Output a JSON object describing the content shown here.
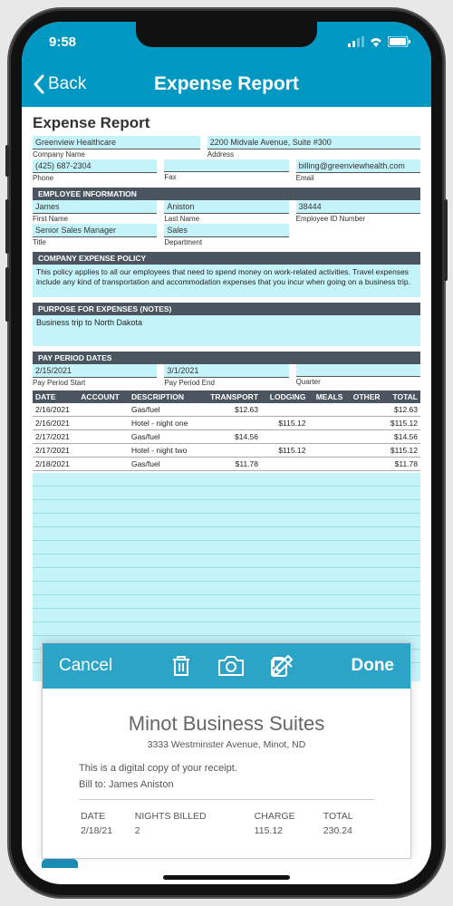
{
  "status": {
    "time": "9:58"
  },
  "nav": {
    "back": "Back",
    "title": "Expense Report"
  },
  "report": {
    "title": "Expense Report",
    "company": {
      "name": "Greenview Healthcare",
      "address": "2200 Midvale Avenue, Suite #300",
      "phone": "(425) 687-2304",
      "fax": "",
      "email": "billing@greenviewhealth.com"
    },
    "labels": {
      "company": "Company Name",
      "address": "Address",
      "phone": "Phone",
      "fax": "Fax",
      "email": "Email"
    },
    "sections": {
      "employee": "EMPLOYEE INFORMATION",
      "policy": "COMPANY EXPENSE POLICY",
      "purpose": "PURPOSE FOR EXPENSES (NOTES)",
      "payperiod": "PAY PERIOD DATES"
    },
    "employee": {
      "first": "James",
      "last": "Aniston",
      "id": "38444",
      "title": "Senior Sales Manager",
      "dept": "Sales"
    },
    "emp_labels": {
      "first": "First Name",
      "last": "Last Name",
      "id": "Employee ID Number",
      "title": "Title",
      "dept": "Department"
    },
    "policy_text": "This policy applies to all our employees that need to spend money on work-related activities. Travel expenses include any kind of transportation and accommodation expenses that you incur when going on a business trip.",
    "purpose_text": "Business trip to North Dakota",
    "period": {
      "start": "2/15/2021",
      "end": "3/1/2021",
      "quarter": ""
    },
    "period_labels": {
      "start": "Pay Period Start",
      "end": "Pay Period End",
      "quarter": "Quarter"
    },
    "table": {
      "headers": {
        "date": "DATE",
        "account": "ACCOUNT",
        "desc": "DESCRIPTION",
        "transport": "TRANSPORT",
        "lodging": "LODGING",
        "meals": "MEALS",
        "other": "OTHER",
        "total": "TOTAL"
      },
      "rows": [
        {
          "date": "2/16/2021",
          "account": "",
          "desc": "Gas/fuel",
          "transport": "$12.63",
          "lodging": "",
          "meals": "",
          "other": "",
          "total": "$12.63"
        },
        {
          "date": "2/16/2021",
          "account": "",
          "desc": "Hotel - night one",
          "transport": "",
          "lodging": "$115.12",
          "meals": "",
          "other": "",
          "total": "$115.12"
        },
        {
          "date": "2/17/2021",
          "account": "",
          "desc": "Gas/fuel",
          "transport": "$14.56",
          "lodging": "",
          "meals": "",
          "other": "",
          "total": "$14.56"
        },
        {
          "date": "2/17/2021",
          "account": "",
          "desc": "Hotel - night two",
          "transport": "",
          "lodging": "$115.12",
          "meals": "",
          "other": "",
          "total": "$115.12"
        },
        {
          "date": "2/18/2021",
          "account": "",
          "desc": "Gas/fuel",
          "transport": "$11.78",
          "lodging": "",
          "meals": "",
          "other": "",
          "total": "$11.78"
        }
      ]
    }
  },
  "modal": {
    "cancel": "Cancel",
    "done": "Done",
    "receipt": {
      "title": "Minot Business Suites",
      "address": "3333 Westminster Avenue, Minot, ND",
      "note": "This is a digital copy of your receipt.",
      "billto_label": "Bill to:",
      "billto": "James Aniston",
      "cols": {
        "date": "DATE",
        "nights": "NIGHTS BILLED",
        "charge": "CHARGE",
        "total": "TOTAL"
      },
      "vals": {
        "date": "2/18/21",
        "nights": "2",
        "charge": "115.12",
        "total": "230.24"
      }
    }
  }
}
